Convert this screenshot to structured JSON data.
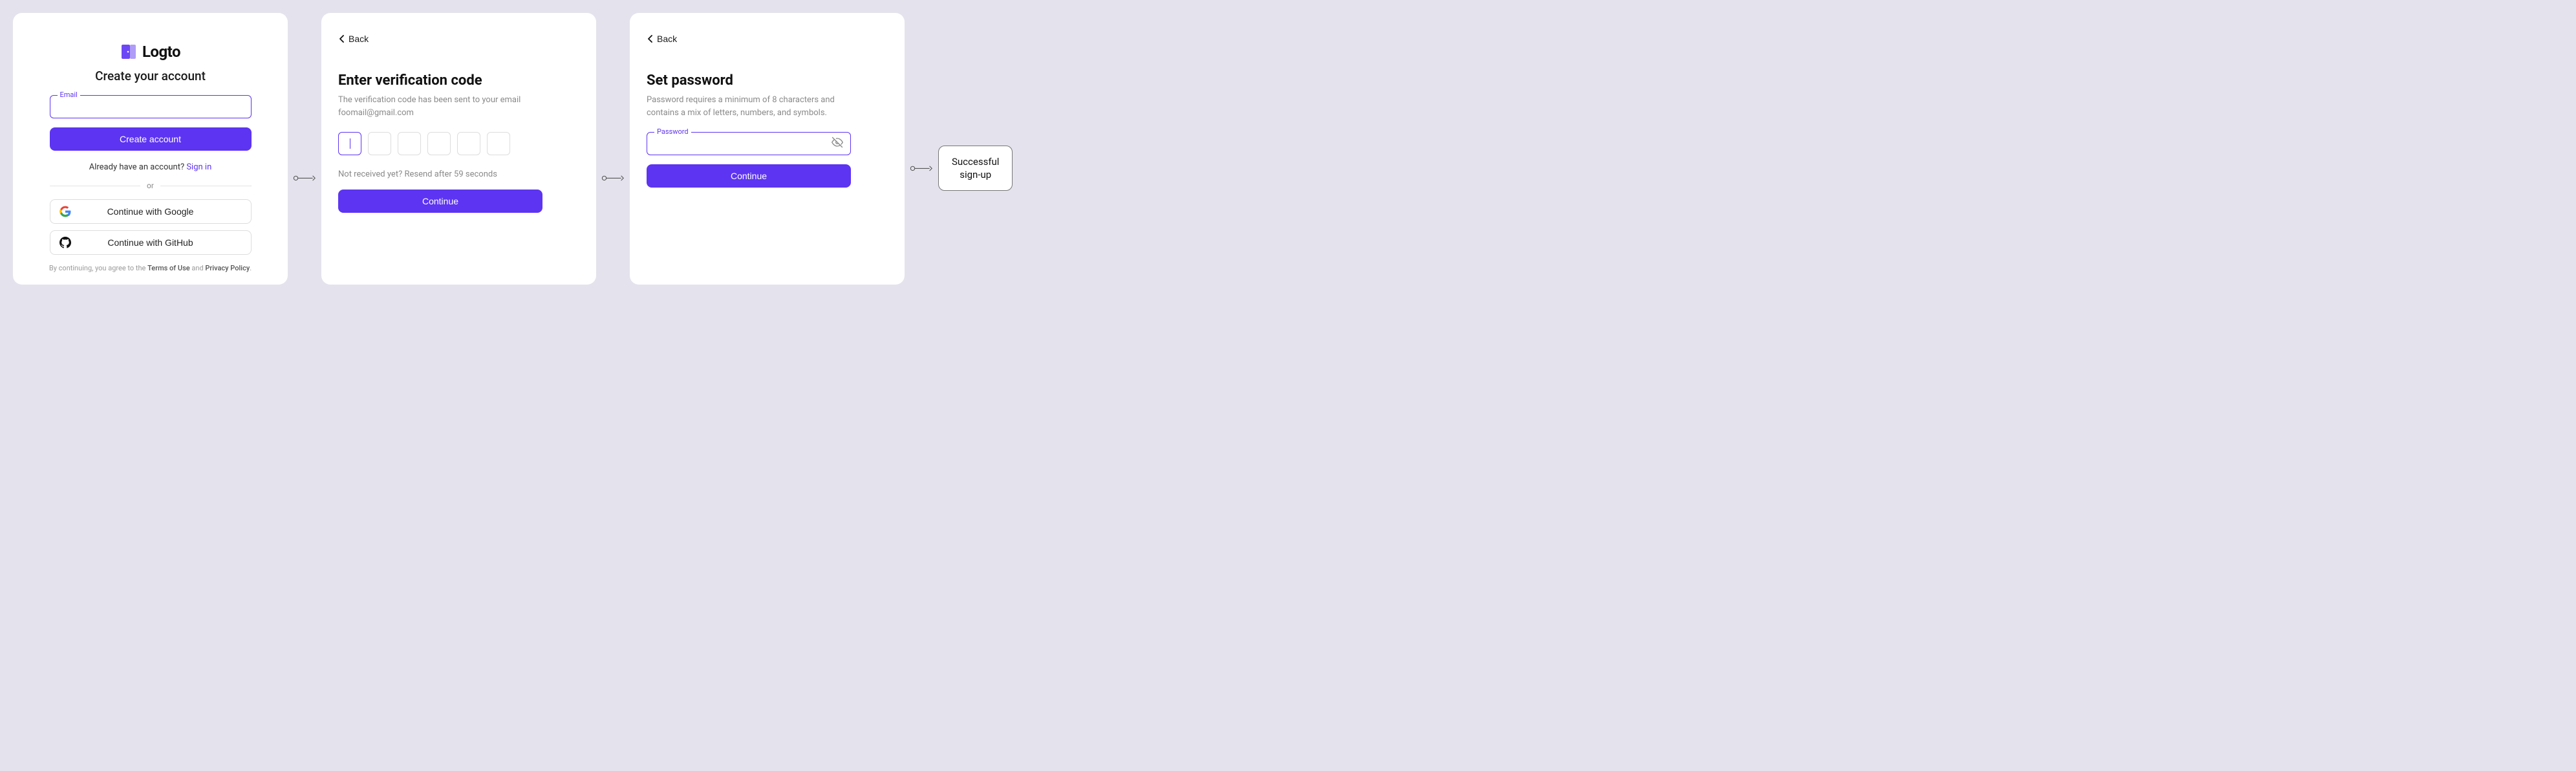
{
  "card1": {
    "brand": "Logto",
    "heading": "Create your account",
    "email_label": "Email",
    "create_btn": "Create account",
    "already_text": "Already have an account? ",
    "signin_link": "Sign in",
    "divider": "or",
    "google_btn": "Continue with Google",
    "github_btn": "Continue with GitHub",
    "legal_pre": "By continuing, you agree to the ",
    "terms": "Terms of Use",
    "legal_mid": " and ",
    "privacy": "Privacy Policy",
    "legal_suf": "."
  },
  "card2": {
    "back": "Back",
    "title": "Enter verification code",
    "subtitle": "The verification code has been sent to your email foomail@gmail.com",
    "resend": "Not received yet? Resend after 59 seconds",
    "continue_btn": "Continue"
  },
  "card3": {
    "back": "Back",
    "title": "Set password",
    "subtitle": "Password requires a minimum of 8 characters and contains a mix of letters, numbers, and symbols.",
    "password_label": "Password",
    "continue_btn": "Continue"
  },
  "final": {
    "line1": "Successful",
    "line2": "sign-up"
  }
}
